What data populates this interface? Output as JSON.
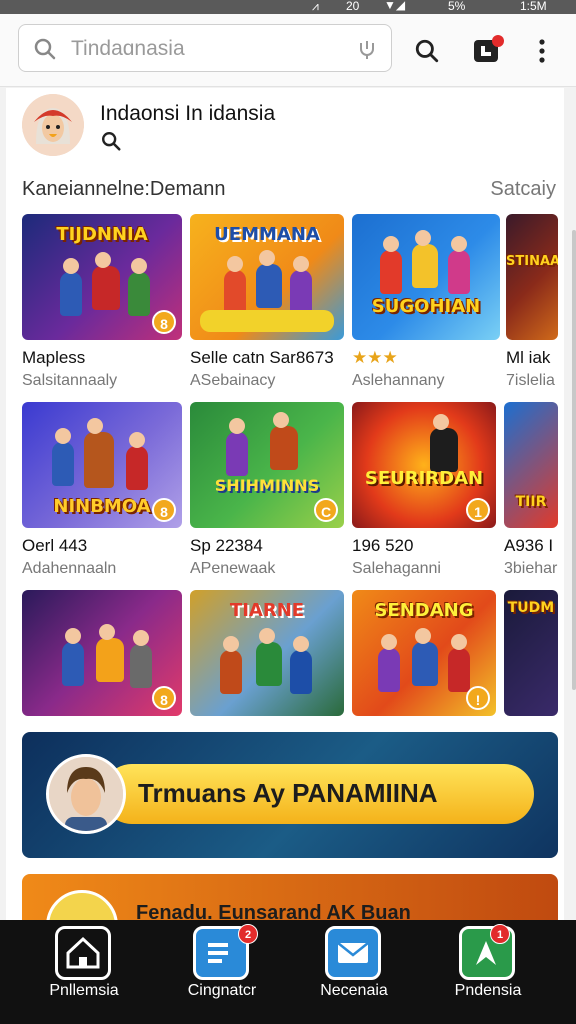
{
  "status_bar": {
    "time": "1:5M",
    "battery": "5%",
    "extra": "20"
  },
  "search": {
    "placeholder": "Tindaɑnasia"
  },
  "profile": {
    "name": "Indaonsi In idansia"
  },
  "section": {
    "title": "Kaneiannelne:Demann",
    "link": "Satcaiy"
  },
  "games": [
    {
      "title": "TIJDNNIA",
      "name": "Mapless",
      "sub": "Salsitannaaly",
      "badge": "8"
    },
    {
      "title": "UEMMANA",
      "name": "Selle catn Sar8673",
      "sub": "ASebainacy",
      "badge": ""
    },
    {
      "title": "SUGOHIAN",
      "name": "★★★",
      "sub": "Aslehannany",
      "badge": ""
    },
    {
      "title": "STINAA",
      "name": "Ml iak",
      "sub": "7islelia",
      "badge": ""
    },
    {
      "title": "NINBMOA",
      "name": "Oerl 443",
      "sub": "Adahennaaln",
      "badge": "8"
    },
    {
      "title": "SHIHMINNS",
      "name": "Sp 22384",
      "sub": "APenewaak",
      "badge": "C"
    },
    {
      "title": "SEURIRDAN",
      "name": "196 520",
      "sub": "Salehaganni",
      "badge": "1"
    },
    {
      "title": "TIIR",
      "name": "A936 I",
      "sub": "3biehar",
      "badge": ""
    },
    {
      "title": "",
      "name": "",
      "sub": "",
      "badge": "8"
    },
    {
      "title": "TIARNE",
      "name": "",
      "sub": "",
      "badge": ""
    },
    {
      "title": "SENDANG",
      "name": "",
      "sub": "",
      "badge": "!"
    },
    {
      "title": "TUDM",
      "name": "",
      "sub": "",
      "badge": ""
    }
  ],
  "banner": {
    "text": "Trmuans Ay PANAMIINA"
  },
  "banner2": {
    "text": "Fenadu. Eunsarand AK Buan"
  },
  "nav": [
    {
      "label": "Pnllemsia",
      "badge": ""
    },
    {
      "label": "Cingnatcr",
      "badge": "2"
    },
    {
      "label": "Necenaia",
      "badge": ""
    },
    {
      "label": "Pndensia",
      "badge": "1"
    }
  ],
  "colors": {
    "accent": "#f4b21a",
    "nav_bg": "#111111"
  }
}
